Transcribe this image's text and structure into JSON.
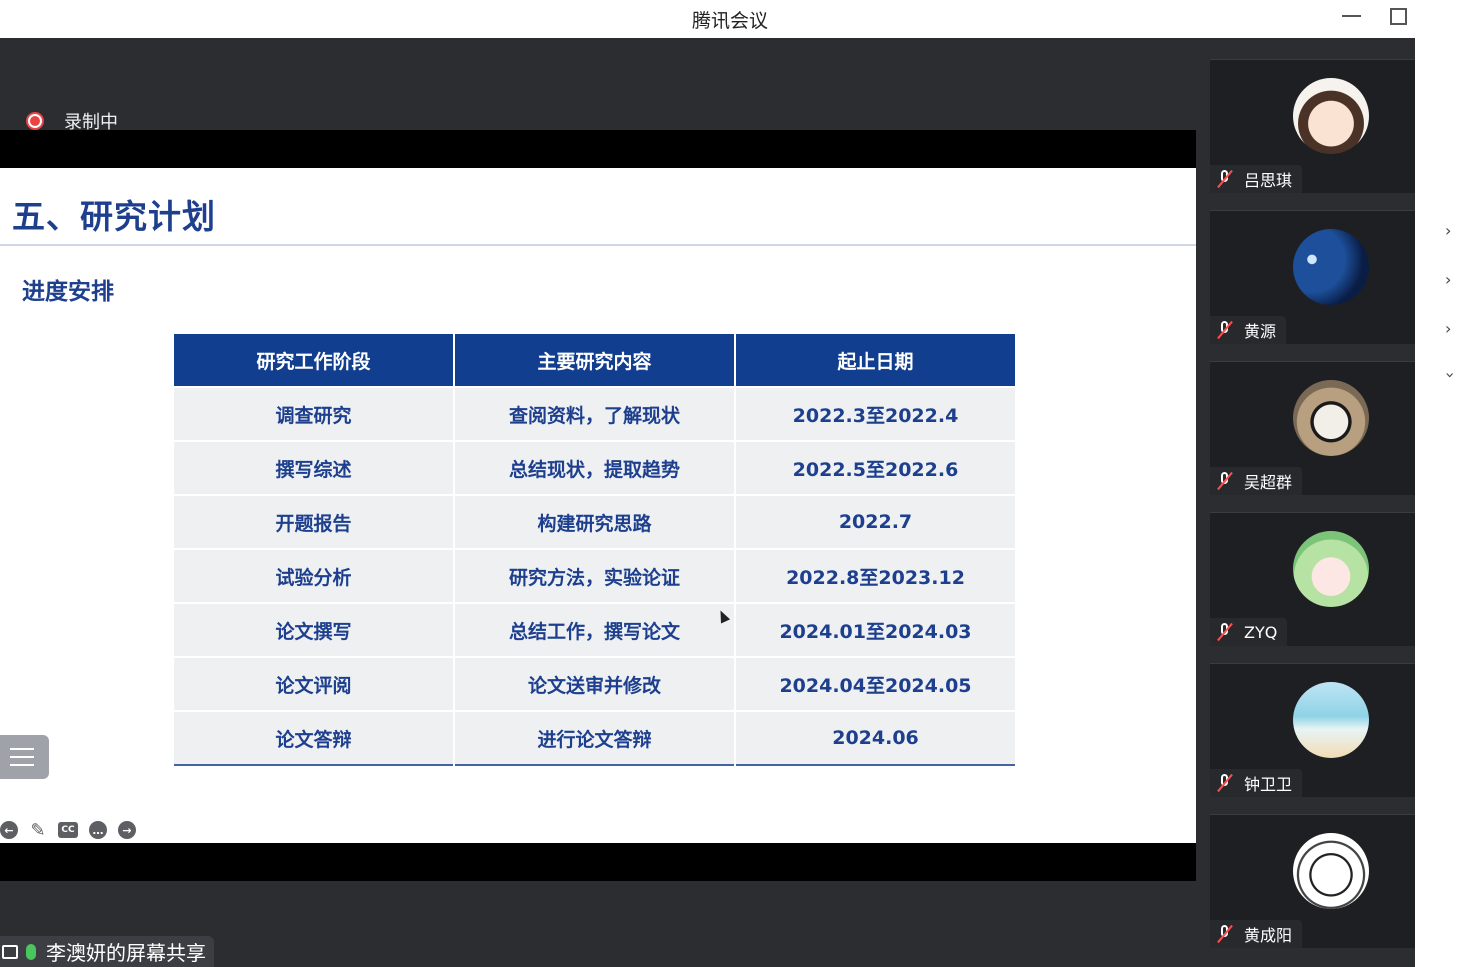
{
  "window": {
    "title": "腾讯会议"
  },
  "recording": {
    "label": "录制中"
  },
  "slide": {
    "title": "五、研究计划",
    "subtitle": "进度安排",
    "table": {
      "headers": [
        "研究工作阶段",
        "主要研究内容",
        "起止日期"
      ],
      "rows": [
        [
          "调查研究",
          "查阅资料，了解现状",
          "2022.3至2022.4"
        ],
        [
          "撰写综述",
          "总结现状，提取趋势",
          "2022.5至2022.6"
        ],
        [
          "开题报告",
          "构建研究思路",
          "2022.7"
        ],
        [
          "试验分析",
          "研究方法，实验论证",
          "2022.8至2023.12"
        ],
        [
          "论文撰写",
          "总结工作，撰写论文",
          "2024.01至2024.03"
        ],
        [
          "论文评阅",
          "论文送审并修改",
          "2024.04至2024.05"
        ],
        [
          "论文答辩",
          "进行论文答辩",
          "2024.06"
        ]
      ]
    }
  },
  "toolbar_icons": [
    "prev-icon",
    "pen-icon",
    "cc-icon",
    "more-icon",
    "next-icon"
  ],
  "share": {
    "label": "李澳妍的屏幕共享"
  },
  "participants": [
    {
      "name": "吕思琪",
      "muted": true
    },
    {
      "name": "黄源",
      "muted": true
    },
    {
      "name": "吴超群",
      "muted": true
    },
    {
      "name": "ZYQ",
      "muted": true
    },
    {
      "name": "钟卫卫",
      "muted": true
    },
    {
      "name": "黄成阳",
      "muted": true
    }
  ],
  "colors": {
    "accent": "#113e8e",
    "text_blue": "#1d3f8e",
    "record_red": "#e84444",
    "mic_green": "#4bc55e"
  }
}
